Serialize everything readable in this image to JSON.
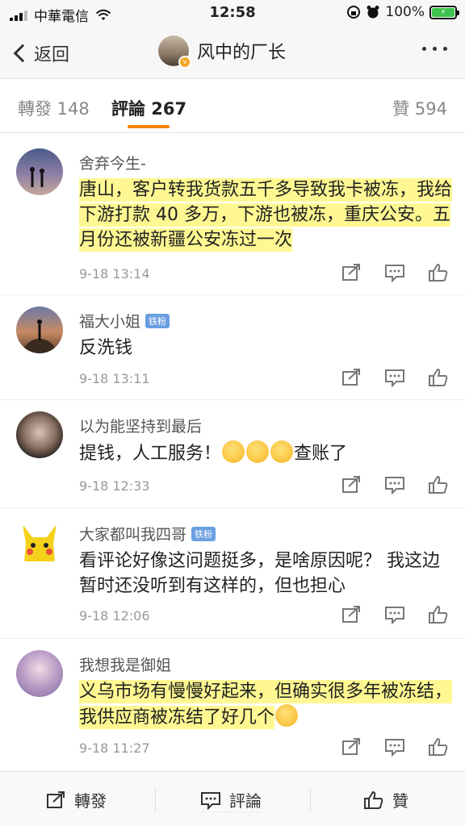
{
  "status_bar": {
    "carrier": "中華電信",
    "time": "12:58",
    "battery_percent": "100%",
    "battery_level": 1.0
  },
  "nav": {
    "back_label": "返回",
    "title": "风中的厂长"
  },
  "tabs": {
    "reposts": "轉發 148",
    "comments": "評論 267",
    "likes": "贊 594",
    "active": "comments"
  },
  "comments": [
    {
      "user": "舍弃今生-",
      "badge": "",
      "text": "唐山，客户转我货款五千多导致我卡被冻，我给下游打款 40 多万，下游也被冻，重庆公安。五月份还被新疆公安冻过一次",
      "time": "9-18 13:14",
      "highlighted": true
    },
    {
      "user": "福大小姐",
      "badge": "铁粉",
      "text": "反洗钱",
      "time": "9-18 13:11",
      "highlighted": false
    },
    {
      "user": "以为能坚持到最后",
      "badge": "",
      "text": "提钱，人工服务！",
      "text_suffix": "查账了",
      "time": "9-18 12:33",
      "highlighted": false
    },
    {
      "user": "大家都叫我四哥",
      "badge": "铁粉",
      "text": "看评论好像这问题挺多，是啥原因呢？ 我这边暂时还没听到有这样的，但也担心",
      "time": "9-18 12:06",
      "highlighted": false
    },
    {
      "user": "我想我是御姐",
      "badge": "",
      "text": "义乌市场有慢慢好起来，但确实很多年被冻结，我供应商被冻结了好几个",
      "time": "9-18 11:27",
      "highlighted": true
    }
  ],
  "bottom_bar": {
    "repost": "轉發",
    "comment": "評論",
    "like": "贊"
  },
  "colors": {
    "accent": "#ff8200",
    "highlight": "#fff56e",
    "badge": "#6a9fe0"
  }
}
